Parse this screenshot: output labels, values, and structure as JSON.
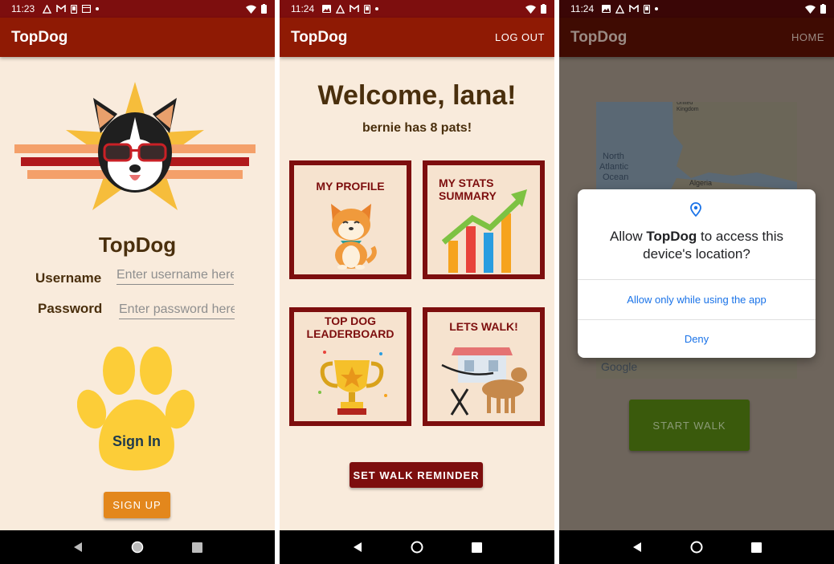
{
  "colors": {
    "status_bar": "#7d0e0e",
    "app_bar": "#8f1a04",
    "background": "#f9ebdc",
    "brown_text": "#4a2f0d",
    "dark_red": "#7d0e0e",
    "paw_yellow": "#fccd38",
    "signup_orange": "#e3871c",
    "start_walk_green": "#3a5a0c",
    "dialog_blue": "#1a73e8"
  },
  "screen1": {
    "status": {
      "time": "11:23"
    },
    "app_title": "TopDog",
    "heading": "TopDog",
    "username_label": "Username",
    "username_placeholder": "Enter username here",
    "password_label": "Password",
    "password_placeholder": "Enter password here",
    "signin_label": "Sign In",
    "signup_label": "SIGN UP"
  },
  "screen2": {
    "status": {
      "time": "11:24"
    },
    "app_title": "TopDog",
    "logout_label": "LOG OUT",
    "welcome": "Welcome, lana!",
    "pats": "bernie has 8 pats!",
    "tiles": [
      {
        "label": "MY PROFILE",
        "icon": "shiba-dog-icon"
      },
      {
        "label_line1": "MY STATS",
        "label_line2": "SUMMARY",
        "icon": "stats-chart-icon"
      },
      {
        "label_line1": "TOP DOG",
        "label_line2": "LEADERBOARD",
        "icon": "trophy-icon"
      },
      {
        "label": "LETS WALK!",
        "icon": "dog-walk-icon"
      }
    ],
    "reminder_label": "SET WALK REMINDER"
  },
  "screen3": {
    "status": {
      "time": "11:24"
    },
    "app_title": "TopDog",
    "home_label": "HOME",
    "map_labels": {
      "kingdom": "United Kingdom",
      "ocean_line1": "North",
      "ocean_line2": "Atlantic",
      "ocean_line3": "Ocean",
      "algeria": "Algeria",
      "google": "Google"
    },
    "start_walk_label": "START WALK",
    "dialog": {
      "title_prefix": "Allow ",
      "title_app": "TopDog",
      "title_suffix": " to access this device's location?",
      "allow_label": "Allow only while using the app",
      "deny_label": "Deny"
    }
  }
}
